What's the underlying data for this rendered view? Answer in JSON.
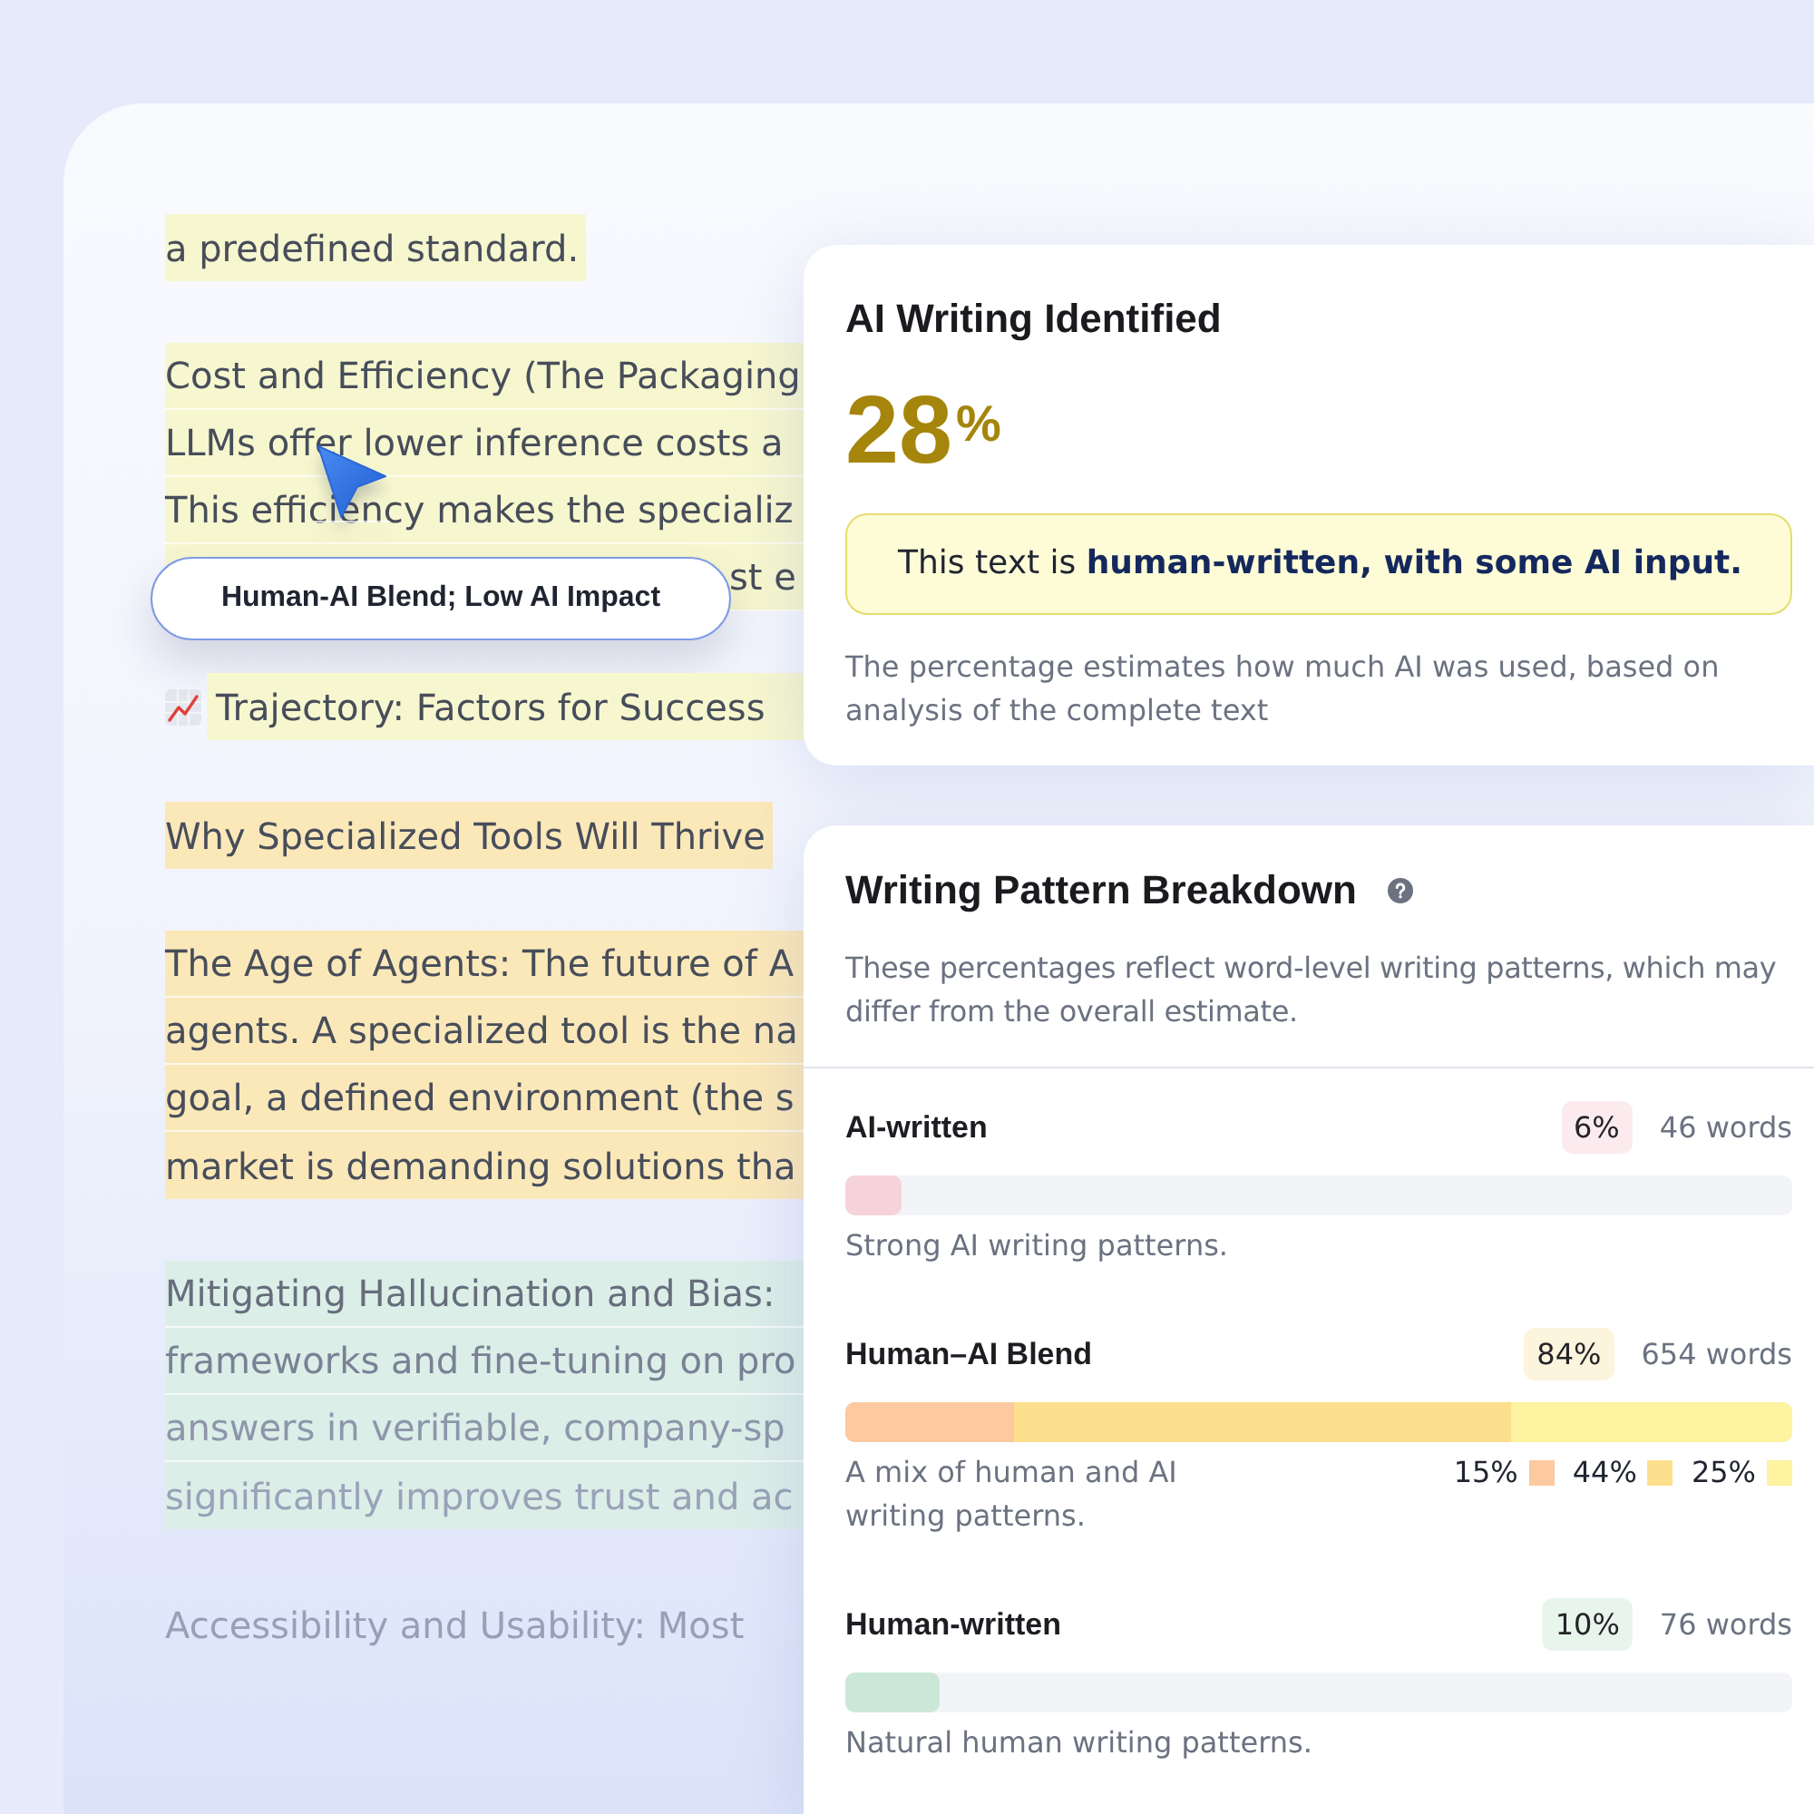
{
  "document": {
    "paragraphs": [
      {
        "kind": "text",
        "color": "#f7f7cf",
        "lines": [
          "a predefined standard."
        ]
      },
      {
        "kind": "text",
        "color": "#f7f7cf",
        "lines": [
          "Cost and Efficiency (The Packaging",
          "LLMs offer lower inference costs a",
          "This efficiency makes the specializ",
          "st e"
        ],
        "tooltip": {
          "label": "Human-AI Blend; Low AI Impact"
        }
      },
      {
        "kind": "icon-line",
        "color": "#f7f7cf",
        "lines": [
          "Trajectory: Factors for Success"
        ]
      },
      {
        "kind": "text",
        "color": "#fbe8b9",
        "lines": [
          "Why Specialized Tools Will Thrive"
        ]
      },
      {
        "kind": "text",
        "color": "#fbe8b9",
        "lines": [
          "The Age of Agents: The future of A",
          "agents. A specialized tool is the na",
          "goal, a defined environment (the s",
          "market is demanding solutions tha"
        ]
      },
      {
        "kind": "text",
        "color": "#dceee8",
        "lines": [
          "Mitigating Hallucination and Bias:",
          "frameworks and fine-tuning on pro",
          "answers in verifiable, company-sp",
          "significantly improves trust and ac"
        ]
      },
      {
        "kind": "text",
        "lines": [
          "Accessibility and Usability: Most"
        ]
      }
    ]
  },
  "result": {
    "title": "AI Writing Identified",
    "score": "28",
    "unit": "%",
    "verdict": "This text is **human-written, with some AI input.**",
    "note": "The percentage estimates how much AI was used, based on analysis of the complete text"
  },
  "breakdown": {
    "title": "Writing Pattern Breakdown",
    "description": "These percentages reflect word-level writing patterns, which may differ from the overall estimate.",
    "categories": [
      {
        "kind": "bar",
        "label": "AI-written",
        "percent": "6%",
        "words": "46 words",
        "level": 0.06,
        "color": "#f6d3da",
        "description": "Strong AI writing patterns."
      },
      {
        "kind": "segmented",
        "label": "Human–AI Blend",
        "percent": "84%",
        "words": "654 words",
        "color": "#fdf4de",
        "segments": [
          {
            "label": "15%",
            "color": "#fcc9a0"
          },
          {
            "label": "44%",
            "color": "#fde08e"
          },
          {
            "label": "25%",
            "color": "#fef3a0"
          }
        ],
        "description": "A mix of human and AI writing patterns."
      },
      {
        "kind": "bar",
        "label": "Human-written",
        "percent": "10%",
        "words": "76 words",
        "level": 0.1,
        "color": "#cbe8d6",
        "description": "Natural human writing patterns."
      }
    ]
  }
}
